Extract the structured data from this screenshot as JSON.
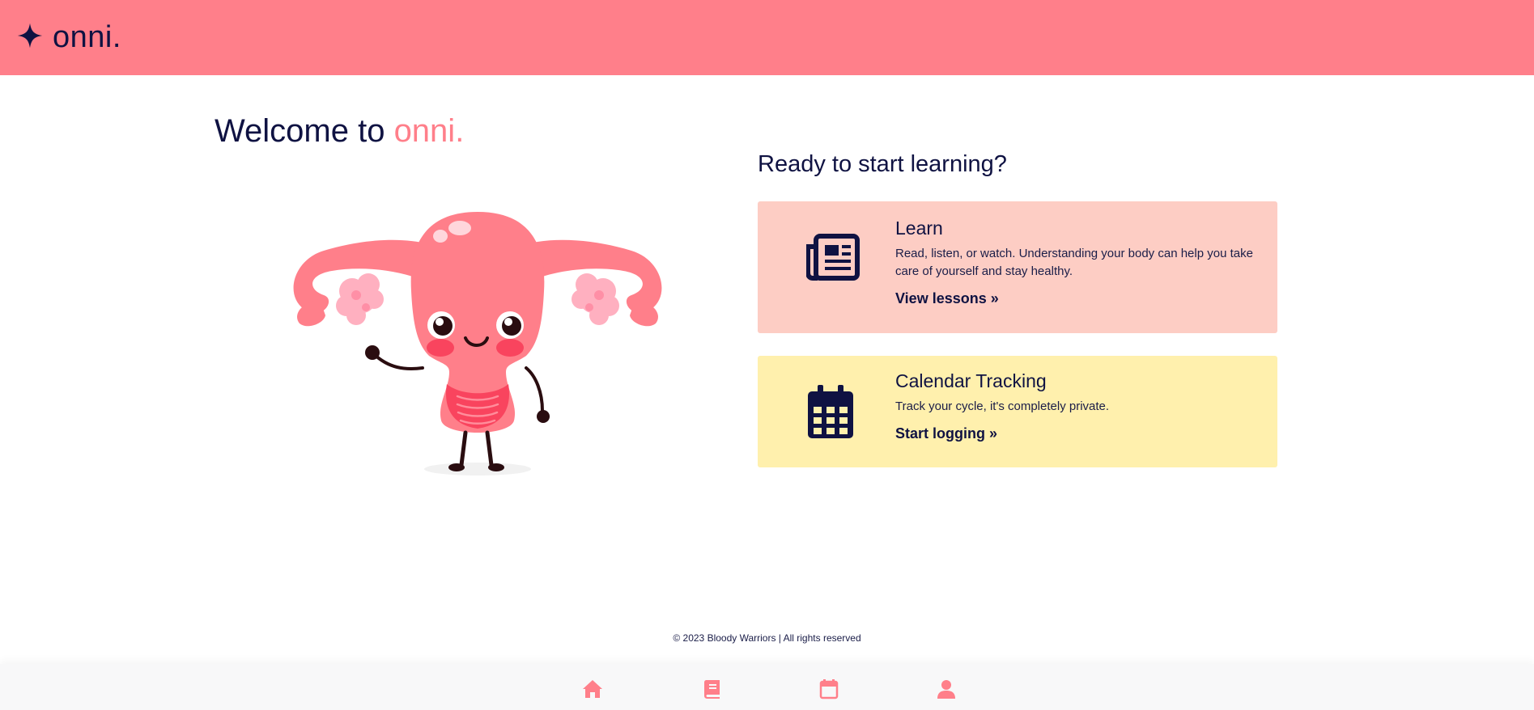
{
  "header": {
    "brand_name": "onni."
  },
  "welcome": {
    "prefix": "Welcome to ",
    "brand": "onni."
  },
  "main": {
    "heading": "Ready to start learning?",
    "cards": [
      {
        "title": "Learn",
        "text": "Read, listen, or watch. Understanding your body can help you take care of yourself and stay healthy.",
        "link": "View lessons »",
        "icon": "newspaper-icon",
        "bg_color": "#fdcdc4"
      },
      {
        "title": "Calendar Tracking",
        "text": "Track your cycle, it's completely private.",
        "link": "Start logging »",
        "icon": "calendar-icon",
        "bg_color": "#fff0ad"
      }
    ]
  },
  "footer": {
    "text": "© 2023 Bloody Warriors | All rights reserved"
  },
  "bottom_nav": {
    "items": [
      {
        "icon": "home-icon"
      },
      {
        "icon": "book-icon"
      },
      {
        "icon": "calendar-icon"
      },
      {
        "icon": "user-icon"
      }
    ]
  },
  "colors": {
    "brand_pink": "#ff7f8a",
    "navy": "#0f1242",
    "learn_card": "#fdcdc4",
    "calendar_card": "#fff0ad"
  }
}
